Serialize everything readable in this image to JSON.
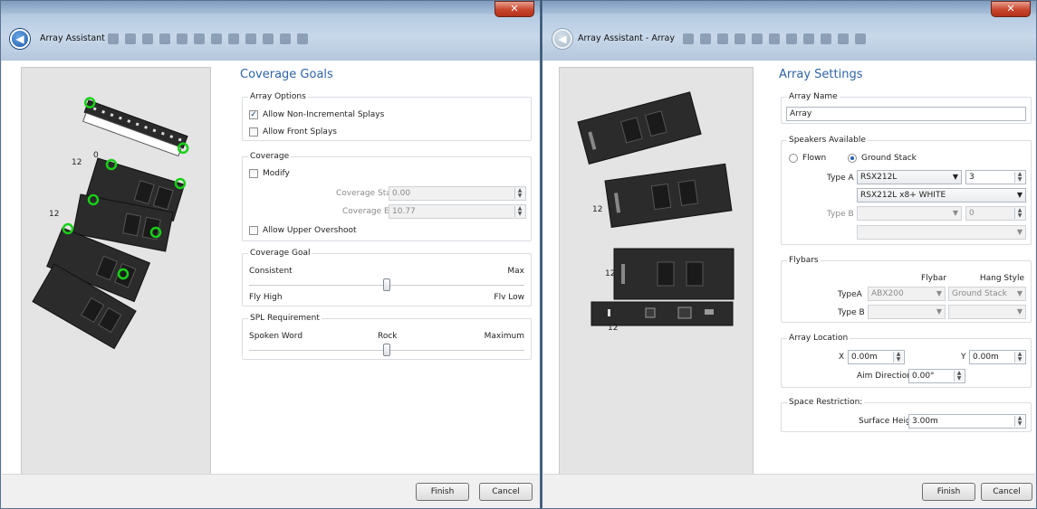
{
  "left_window": {
    "title": "Array Assistant",
    "heading": "Coverage Goals",
    "array_options": {
      "title": "Array Options",
      "allow_non_incremental": "Allow Non-Incremental Splays",
      "allow_front": "Allow Front Splays"
    },
    "coverage": {
      "title": "Coverage",
      "modify": "Modify",
      "start_label": "Coverage Start",
      "start_value": "0.00",
      "end_label": "Coverage End",
      "end_value": "10.77",
      "allow_upper": "Allow Upper Overshoot"
    },
    "coverage_goal": {
      "title": "Coverage Goal",
      "left_top": "Consistent",
      "right_top": "Max",
      "left_bottom": "Fly High",
      "right_bottom": "Flv Low",
      "level": 0.5
    },
    "spl": {
      "title": "SPL Requirement",
      "left": "Spoken Word",
      "center": "Rock",
      "right": "Maximum",
      "level": 0.5
    },
    "splay_labels": [
      "0",
      "12",
      "12"
    ],
    "finish": "Finish",
    "cancel": "Cancel"
  },
  "right_window": {
    "title": "Array Assistant - Array",
    "heading": "Array Settings",
    "array_name": {
      "title": "Array Name",
      "value": "Array"
    },
    "speakers": {
      "title": "Speakers Available",
      "flown": "Flown",
      "ground": "Ground Stack",
      "type_a_label": "Type A",
      "type_a_value": "RSX212L",
      "type_a_count": "3",
      "type_a_config": "RSX212L x8+ WHITE",
      "type_b_label": "Type B",
      "type_b_count": "0"
    },
    "flybars": {
      "title": "Flybars",
      "col_flybar": "Flybar",
      "col_hang": "Hang Style",
      "type_a_label": "TypeA",
      "type_a_flybar": "ABX200",
      "type_a_hang": "Ground Stack",
      "type_b_label": "Type B"
    },
    "location": {
      "title": "Array Location",
      "x_label": "X",
      "x_value": "0.00m",
      "y_label": "Y",
      "y_value": "0.00m",
      "aim_label": "Aim Direction",
      "aim_value": "0.00°"
    },
    "space": {
      "title": "Space Restriction:",
      "surface_label": "Surface Height",
      "surface_value": "3.00m"
    },
    "splay_labels": [
      "12",
      "12",
      "12"
    ],
    "finish": "Finish",
    "cancel": "Cancel"
  },
  "icons": [
    "back-arrow-icon",
    "close-icon",
    "checkbox-checked-icon",
    "dropdown-arrow-icon",
    "spinner-icon"
  ]
}
